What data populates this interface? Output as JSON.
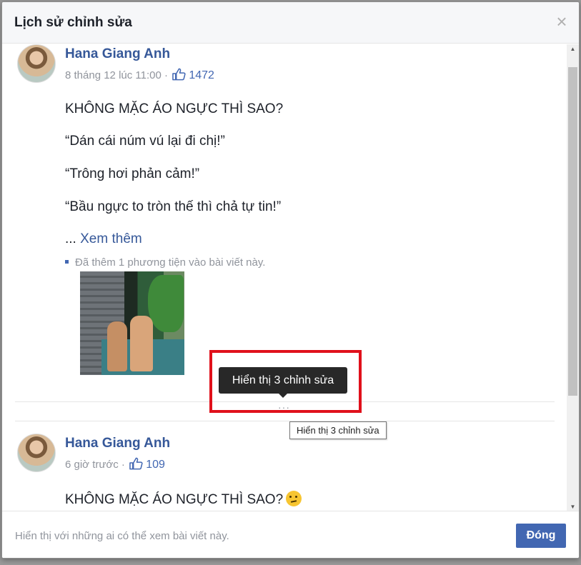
{
  "dialog": {
    "title": "Lịch sử chỉnh sửa",
    "close_glyph": "×"
  },
  "posts": [
    {
      "author": "Hana Giang Anh",
      "time": "8 tháng 12 lúc 11:00",
      "separator": "·",
      "likes": "1472",
      "paragraphs": [
        "KHÔNG MẶC ÁO NGỰC THÌ SAO?",
        "“Dán cái núm vú lại đi chị!”",
        "“Trông hơi phản cảm!”",
        "“Bầu ngực to tròn thế thì chả tự tin!”"
      ],
      "see_more_prefix": "... ",
      "see_more": "Xem thêm",
      "media_note": "Đã thêm 1 phương tiện vào bài viết này."
    },
    {
      "author": "Hana Giang Anh",
      "time": "6 giờ trước",
      "separator": "·",
      "likes": "109",
      "paragraphs": [
        "KHÔNG MẶC ÁO NGỰC THÌ SAO?"
      ]
    }
  ],
  "edits": {
    "dots": "···",
    "tooltip": "Hiển thị 3 chỉnh sửa",
    "tooltip_native": "Hiển thị 3 chỉnh sửa"
  },
  "footer": {
    "audience_text": "Hiển thị với những ai có thể xem bài viết này.",
    "close_button": "Đóng"
  },
  "colors": {
    "link": "#365899",
    "primary_button": "#4267b2",
    "highlight": "#e0101b"
  },
  "icons": {
    "like": "thumbs-up-icon",
    "emoji": "thinking-face-icon"
  }
}
